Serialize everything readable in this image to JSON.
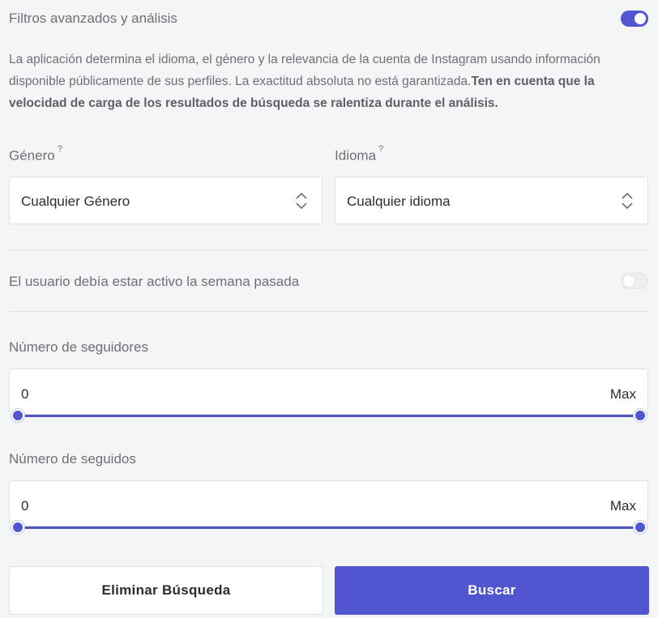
{
  "advanced": {
    "title": "Filtros avanzados y análisis",
    "toggle_on": true,
    "description": "La aplicación determina el idioma, el género y la relevancia de la cuenta de Instagram usando información disponible públicamente de sus perfiles. La exactitud absoluta no está garantizada.",
    "description_bold": "Ten en cuenta que la velocidad de carga de los resultados de búsqueda se ralentiza durante el análisis."
  },
  "gender": {
    "label": "Género",
    "help_mark": "?",
    "value": "Cualquier Género"
  },
  "language": {
    "label": "Idioma",
    "help_mark": "?",
    "value": "Cualquier idioma"
  },
  "active_last_week": {
    "label": "El usuario debía estar activo la semana pasada",
    "toggle_on": false
  },
  "followers": {
    "label": "Número de seguidores",
    "min": "0",
    "max": "Max"
  },
  "following": {
    "label": "Número de seguidos",
    "min": "0",
    "max": "Max"
  },
  "buttons": {
    "clear": "Eliminar Búsqueda",
    "search": "Buscar"
  },
  "colors": {
    "accent": "#5055d0",
    "background": "#f4f5f7"
  }
}
